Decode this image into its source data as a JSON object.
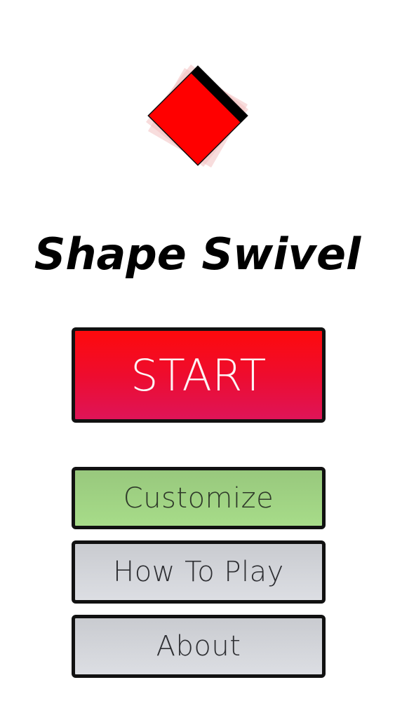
{
  "app": {
    "title": "Shape Swivel"
  },
  "logo": {
    "icon": "rotating-square-icon",
    "fill_color": "#ff0000",
    "edge_color": "#000000",
    "ghost_color": "#f4c6c6"
  },
  "menu": {
    "start_label": "START",
    "customize_label": "Customize",
    "how_to_play_label": "How To Play",
    "about_label": "About"
  },
  "colors": {
    "start_top": "#fe0a0c",
    "start_bottom": "#de1458",
    "customize": "#a0d283",
    "neutral": "#d2d4d9",
    "border": "#111111"
  }
}
